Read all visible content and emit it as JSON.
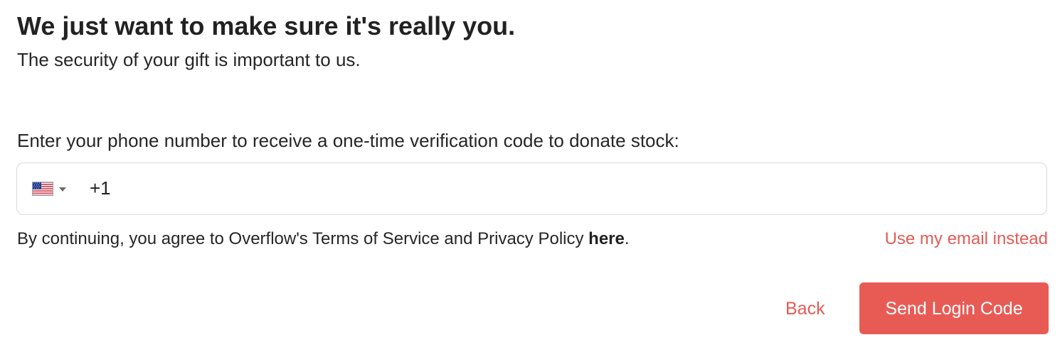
{
  "heading": {
    "title": "We just want to make sure it's really you.",
    "subtitle": "The security of your gift is important to us."
  },
  "phone": {
    "label": "Enter your phone number to receive a one-time verification code to donate stock:",
    "country_flag_icon": "us-flag-icon",
    "dropdown_icon": "caret-down-icon",
    "dial_code": "+1",
    "value": "",
    "placeholder": ""
  },
  "terms": {
    "text": "By continuing, you agree to Overflow's Terms of Service and Privacy Policy ",
    "link": "here",
    "end": "."
  },
  "actions": {
    "email_instead": "Use my email instead",
    "back": "Back",
    "send": "Send Login Code"
  },
  "colors": {
    "accent": "#e85b55",
    "text": "#262626",
    "border": "#d9d9d9"
  }
}
